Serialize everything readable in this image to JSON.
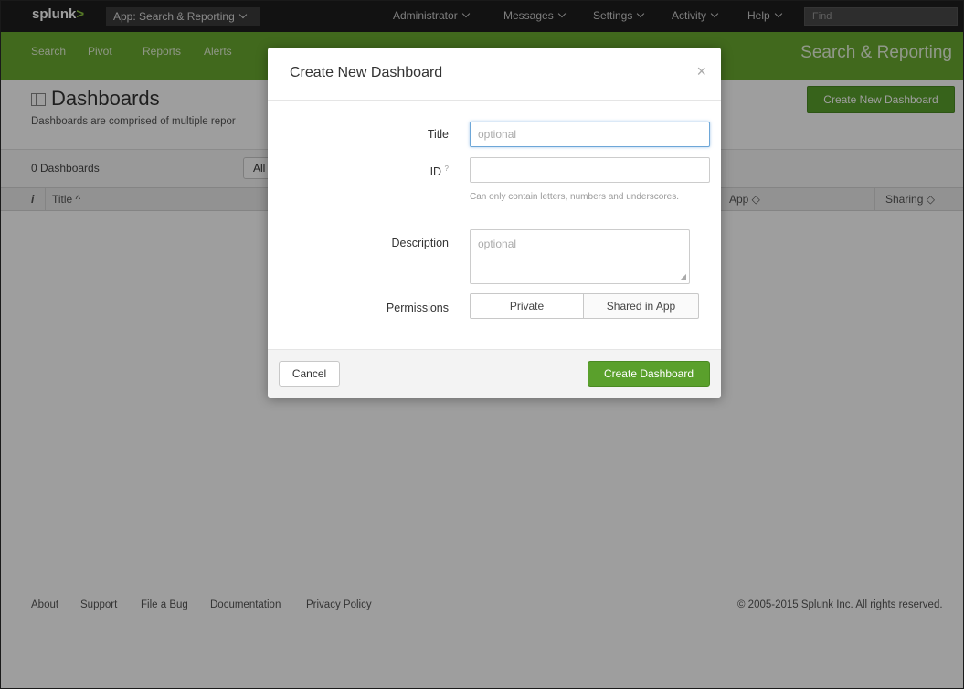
{
  "topbar": {
    "logo": "splunk",
    "logo_suffix": ">",
    "app_select": "App: Search & Reporting",
    "menu": [
      "Administrator",
      "Messages",
      "Settings",
      "Activity",
      "Help"
    ],
    "find_placeholder": "Find"
  },
  "nav": {
    "items": [
      "Search",
      "Pivot",
      "Reports",
      "Alerts"
    ],
    "app_name": "Search & Reporting"
  },
  "page": {
    "title": "Dashboards",
    "description": "Dashboards are comprised of multiple repor",
    "create_button": "Create New Dashboard",
    "count": "0 Dashboards",
    "filter": "All",
    "columns": {
      "info": "i",
      "title": "Title ^",
      "app": "App ◇",
      "sharing": "Sharing ◇"
    }
  },
  "footer": {
    "links": [
      "About",
      "Support",
      "File a Bug",
      "Documentation",
      "Privacy Policy"
    ],
    "copyright": "© 2005-2015 Splunk Inc. All rights reserved."
  },
  "modal": {
    "title": "Create New Dashboard",
    "close": "×",
    "fields": {
      "title_label": "Title",
      "title_placeholder": "optional",
      "id_label": "ID",
      "id_help_mark": "?",
      "id_help": "Can only contain letters, numbers and underscores.",
      "description_label": "Description",
      "description_placeholder": "optional",
      "permissions_label": "Permissions"
    },
    "permissions": [
      "Private",
      "Shared in App"
    ],
    "cancel": "Cancel",
    "submit": "Create Dashboard"
  },
  "colors": {
    "green": "#6aaa2f",
    "button_green": "#5aa02c",
    "topbar": "#1d1d1d"
  }
}
